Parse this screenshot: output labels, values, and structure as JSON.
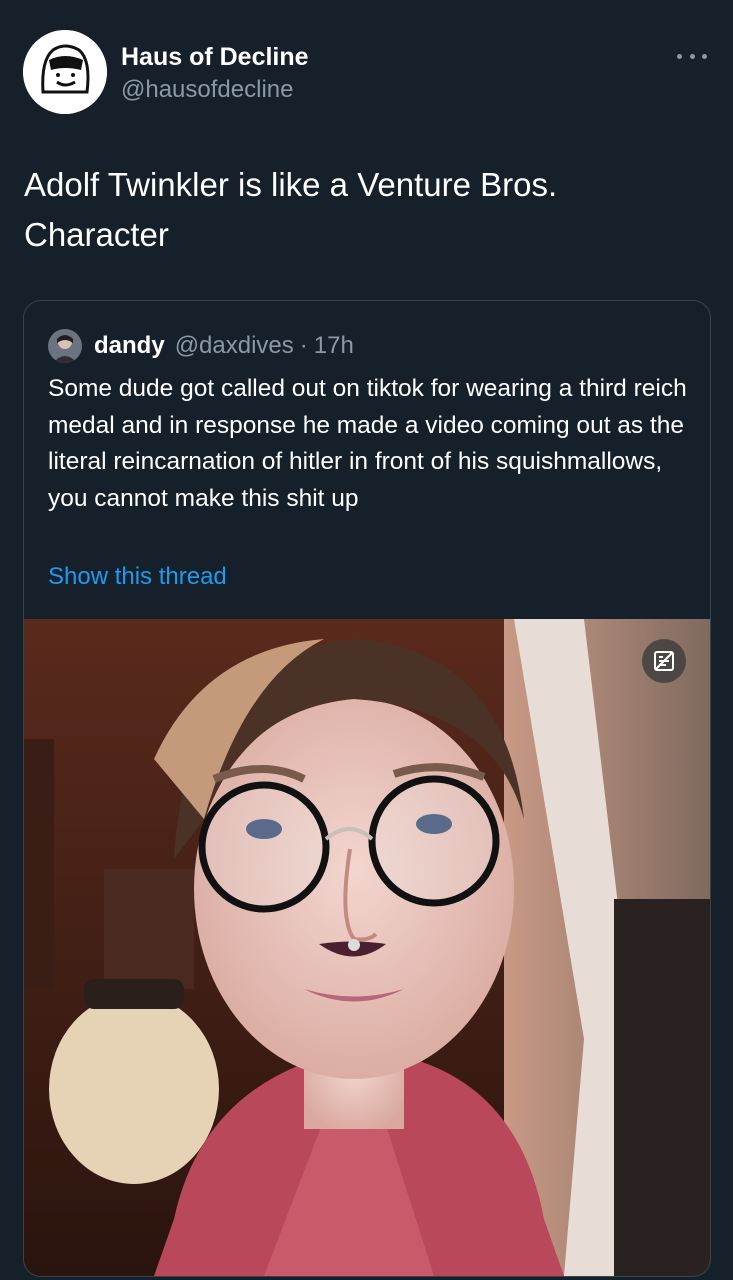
{
  "tweet": {
    "author_name": "Haus of Decline",
    "author_handle": "@hausofdecline",
    "text": "Adolf Twinkler is like a Venture Bros. Character",
    "more_icon": "more-horizontal-icon"
  },
  "quote": {
    "author_name": "dandy",
    "author_handle": "@daxdives",
    "separator": "·",
    "time": "17h",
    "text": "Some dude got called out on tiktok for wearing a third reich medal and in response he made a video coming out as the literal reincarnation of hitler in front of his squishmallows, you cannot make this shit up",
    "show_thread": "Show this thread",
    "media_badge_icon": "media-badge-icon"
  },
  "colors": {
    "background": "#15202b",
    "text_primary": "#ffffff",
    "text_secondary": "#8b98a5",
    "link": "#1d9bf0",
    "border": "#38444d"
  }
}
